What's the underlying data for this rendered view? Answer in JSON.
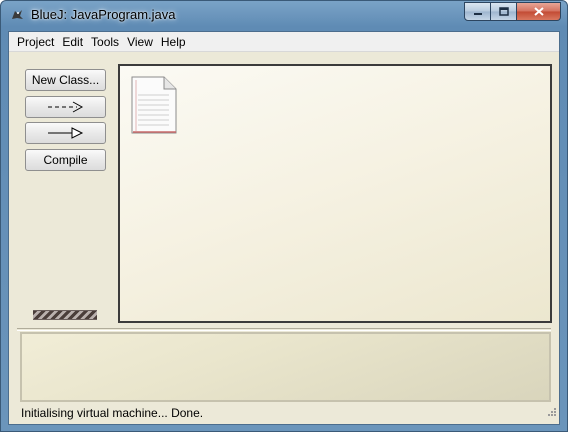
{
  "window": {
    "title": "BlueJ:  JavaProgram.java",
    "icon": "bluej-bird-icon",
    "controls": {
      "minimize": "minimize-icon",
      "maximize": "maximize-icon",
      "close": "close-icon"
    }
  },
  "menubar": {
    "items": [
      "Project",
      "Edit",
      "Tools",
      "View",
      "Help"
    ]
  },
  "sidebar": {
    "new_class": "New Class...",
    "uses_arrow": "dashed-arrow-icon",
    "inherits_arrow": "inheritance-arrow-icon",
    "compile": "Compile"
  },
  "diagram": {
    "items": [
      {
        "icon": "text-file-icon"
      }
    ]
  },
  "status": {
    "message": "Initialising virtual machine... Done."
  },
  "colors": {
    "titlebar": "#6b95bb",
    "client": "#ece9d8",
    "diagram_bg": "#f6f2e3"
  }
}
